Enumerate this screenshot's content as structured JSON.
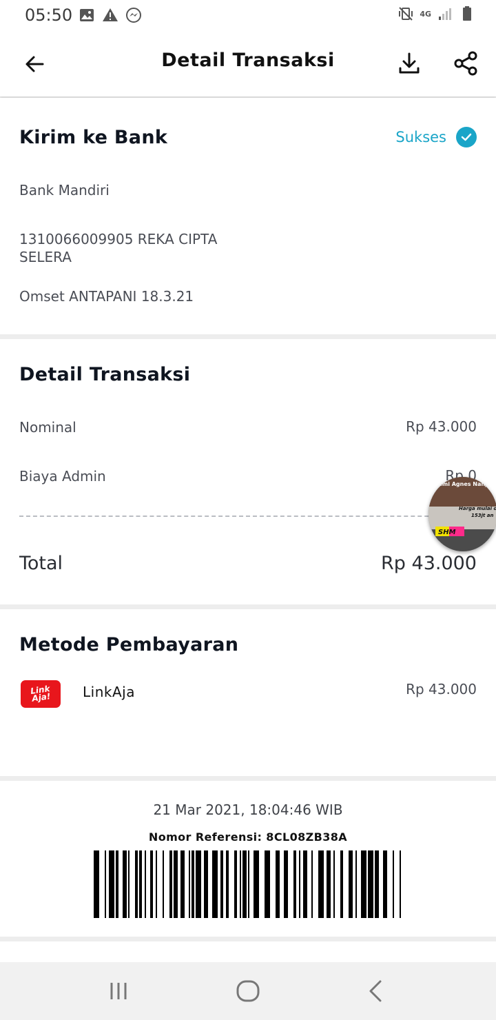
{
  "status_bar": {
    "time": "05:50",
    "network": "4G"
  },
  "header": {
    "title": "Detail Transaksi"
  },
  "transfer": {
    "title": "Kirim ke Bank",
    "status": "Sukses",
    "bank": "Bank Mandiri",
    "account_line1": "1310066009905 REKA CIPTA",
    "account_line2": "SELERA",
    "note": "Omset ANTAPANI 18.3.21"
  },
  "details": {
    "title": "Detail Transaksi",
    "nominal_label": "Nominal",
    "nominal_value": "Rp 43.000",
    "admin_label": "Biaya Admin",
    "admin_value": "Rp 0",
    "total_label": "Total",
    "total_value": "Rp 43.000"
  },
  "payment": {
    "title": "Metode Pembayaran",
    "logo_line1": "Link",
    "logo_line2": "Aja!",
    "method": "LinkAja",
    "amount": "Rp 43.000"
  },
  "receipt": {
    "datetime": "21 Mar 2021, 18:04:46 WIB",
    "reference": "Nomor Referensi: 8CL08ZB38A"
  },
  "bubble": {
    "line1": "Rumi Agnes Nanji",
    "line2": "Harga mulai dr",
    "line3": "153jt an",
    "badge": "SHM"
  },
  "colors": {
    "accent": "#1aa5c8",
    "linkaja_red": "#e8161c"
  }
}
